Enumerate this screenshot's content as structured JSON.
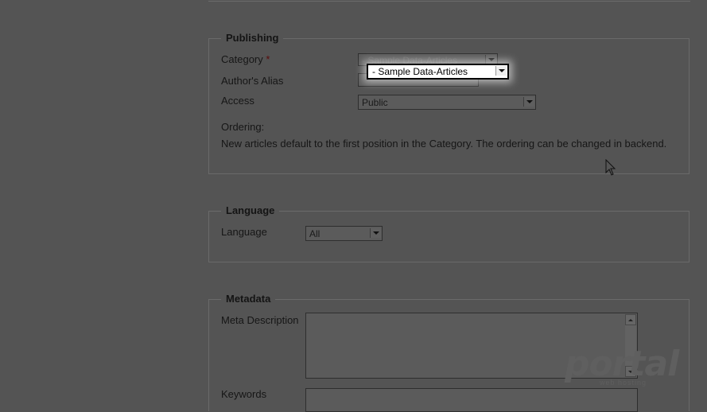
{
  "publishing": {
    "legend": "Publishing",
    "category_label": "Category",
    "required_mark": "*",
    "category_value": "- Sample Data-Articles",
    "authors_alias_label": "Author's Alias",
    "access_label": "Access",
    "access_value": "Public",
    "ordering_label": "Ordering:",
    "ordering_note": "New articles default to the first position in the Category. The ordering can be changed in backend."
  },
  "language": {
    "legend": "Language",
    "label": "Language",
    "value": "All"
  },
  "metadata": {
    "legend": "Metadata",
    "meta_description_label": "Meta Description",
    "keywords_label": "Keywords"
  },
  "dropdown_popup": {
    "selected": "- Sample Data-Articles"
  },
  "watermark": {
    "brand": "portal",
    "tagline": "web hosting"
  },
  "colors": {
    "overlay_background": "#545454",
    "popup_background": "#ffffff",
    "required_marker": "#5a0c0c"
  }
}
